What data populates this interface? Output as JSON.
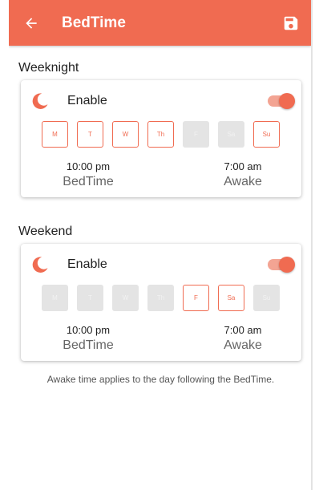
{
  "appbar": {
    "title": "BedTime",
    "back_icon": "arrow-left-icon",
    "save_icon": "floppy-disk-icon",
    "color": "#f06b51"
  },
  "weeknight": {
    "section_title": "Weeknight",
    "enable_label": "Enable",
    "enabled": true,
    "days": [
      {
        "label": "M",
        "selected": true
      },
      {
        "label": "T",
        "selected": true
      },
      {
        "label": "W",
        "selected": true
      },
      {
        "label": "Th",
        "selected": true
      },
      {
        "label": "F",
        "selected": false
      },
      {
        "label": "Sa",
        "selected": false
      },
      {
        "label": "Su",
        "selected": true
      }
    ],
    "bedtime_time": "10:00 pm",
    "bedtime_label": "BedTime",
    "awake_time": "7:00 am",
    "awake_label": "Awake"
  },
  "weekend": {
    "section_title": "Weekend",
    "enable_label": "Enable",
    "enabled": true,
    "days": [
      {
        "label": "M",
        "selected": false
      },
      {
        "label": "T",
        "selected": false
      },
      {
        "label": "W",
        "selected": false
      },
      {
        "label": "Th",
        "selected": false
      },
      {
        "label": "F",
        "selected": true
      },
      {
        "label": "Sa",
        "selected": true
      },
      {
        "label": "Su",
        "selected": false
      }
    ],
    "bedtime_time": "10:00 pm",
    "bedtime_label": "BedTime",
    "awake_time": "7:00 am",
    "awake_label": "Awake"
  },
  "footer_note": "Awake time applies to the day following the BedTime.",
  "colors": {
    "accent": "#f06b51",
    "accent_light": "#f3a493",
    "disabled_day": "#e4e4e4"
  }
}
